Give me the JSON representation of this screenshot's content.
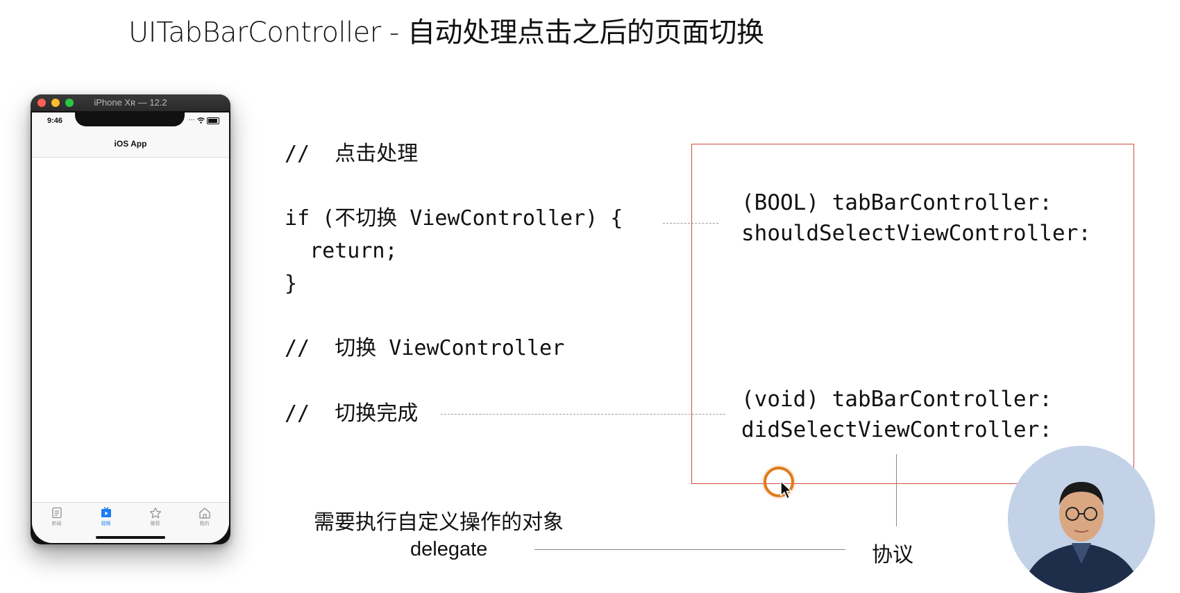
{
  "slide": {
    "title": "UITabBarController - 自动处理点击之后的页面切换"
  },
  "simulator": {
    "window_title": "iPhone Xʀ — 12.2",
    "status_time": "9:46",
    "nav_title": "iOS App",
    "tabs": [
      {
        "label": "新闻",
        "icon": "news-icon",
        "active": false
      },
      {
        "label": "视频",
        "icon": "video-icon",
        "active": true
      },
      {
        "label": "推荐",
        "icon": "star-icon",
        "active": false
      },
      {
        "label": "我的",
        "icon": "home-icon",
        "active": false
      }
    ],
    "active_tab_color": "#1c7cf4",
    "inactive_tab_color": "#8e8e93"
  },
  "code": {
    "comment_tap": "//  点击处理",
    "if_line": "if (不切换 ViewController) {",
    "return_line": "  return;",
    "close_brace": "}",
    "comment_switch": "//  切换 ViewController",
    "comment_done": "//  切换完成"
  },
  "protocol_box": {
    "should_select_line1": "(BOOL) tabBarController:",
    "should_select_line2": "shouldSelectViewController:",
    "did_select_line1": "(void) tabBarController:",
    "did_select_line2": "didSelectViewController:",
    "border_color": "#d04a3c"
  },
  "annotations": {
    "delegate_object_cn": "需要执行自定义操作的对象",
    "delegate_en": "delegate",
    "protocol_cn": "协议"
  },
  "overlay": {
    "cursor_ring_color": "#e07a1a"
  }
}
